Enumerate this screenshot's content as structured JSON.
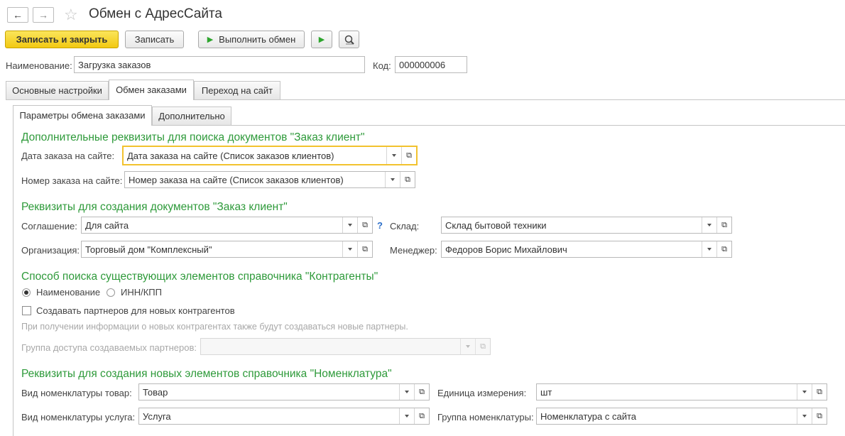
{
  "window": {
    "title": "Обмен с АдресСайта"
  },
  "toolbar": {
    "save_close": "Записать и закрыть",
    "save": "Записать",
    "run_exchange": "Выполнить обмен"
  },
  "header": {
    "name_label": "Наименование:",
    "name_value": "Загрузка заказов",
    "code_label": "Код:",
    "code_value": "000000006"
  },
  "tabs": [
    {
      "label": "Основные настройки"
    },
    {
      "label": "Обмен заказами",
      "active": true
    },
    {
      "label": "Переход на сайт"
    }
  ],
  "subtabs": [
    {
      "label": "Параметры обмена заказами",
      "active": true
    },
    {
      "label": "Дополнительно"
    }
  ],
  "section1": {
    "title": "Дополнительные реквизиты для поиска документов \"Заказ клиент\"",
    "order_date_label": "Дата заказа на сайте:",
    "order_date_value": "Дата заказа на сайте (Список заказов клиентов)",
    "order_num_label": "Номер заказа на сайте:",
    "order_num_value": "Номер заказа на сайте (Список заказов клиентов)"
  },
  "section2": {
    "title": "Реквизиты для создания документов \"Заказ клиент\"",
    "agreement_label": "Соглашение:",
    "agreement_value": "Для сайта",
    "help": "?",
    "warehouse_label": "Склад:",
    "warehouse_value": "Склад бытовой техники",
    "org_label": "Организация:",
    "org_value": "Торговый дом \"Комплексный\"",
    "manager_label": "Менеджер:",
    "manager_value": "Федоров Борис Михайлович"
  },
  "section3": {
    "title": "Способ поиска существующих элементов справочника \"Контрагенты\"",
    "radio_name": "Наименование",
    "radio_inn": "ИНН/КПП",
    "radio_selected": "Наименование",
    "create_partners_label": "Создавать партнеров для новых контрагентов",
    "create_partners_checked": false,
    "hint": "При получении информации о новых контрагентах также будут создаваться новые партнеры.",
    "access_group_label": "Группа доступа создаваемых партнеров:",
    "access_group_value": ""
  },
  "section4": {
    "title": "Реквизиты для создания новых элементов справочника \"Номенклатура\"",
    "goods_kind_label": "Вид номенклатуры товар:",
    "goods_kind_value": "Товар",
    "unit_label": "Единица измерения:",
    "unit_value": "шт",
    "service_kind_label": "Вид номенклатуры услуга:",
    "service_kind_value": "Услуга",
    "group_label": "Группа номенклатуры:",
    "group_value": "Номенклатура с сайта"
  },
  "colors": {
    "section_title": "#2e9a3a",
    "primary_button": "#f2c912",
    "focus_border": "#f2c22e"
  }
}
